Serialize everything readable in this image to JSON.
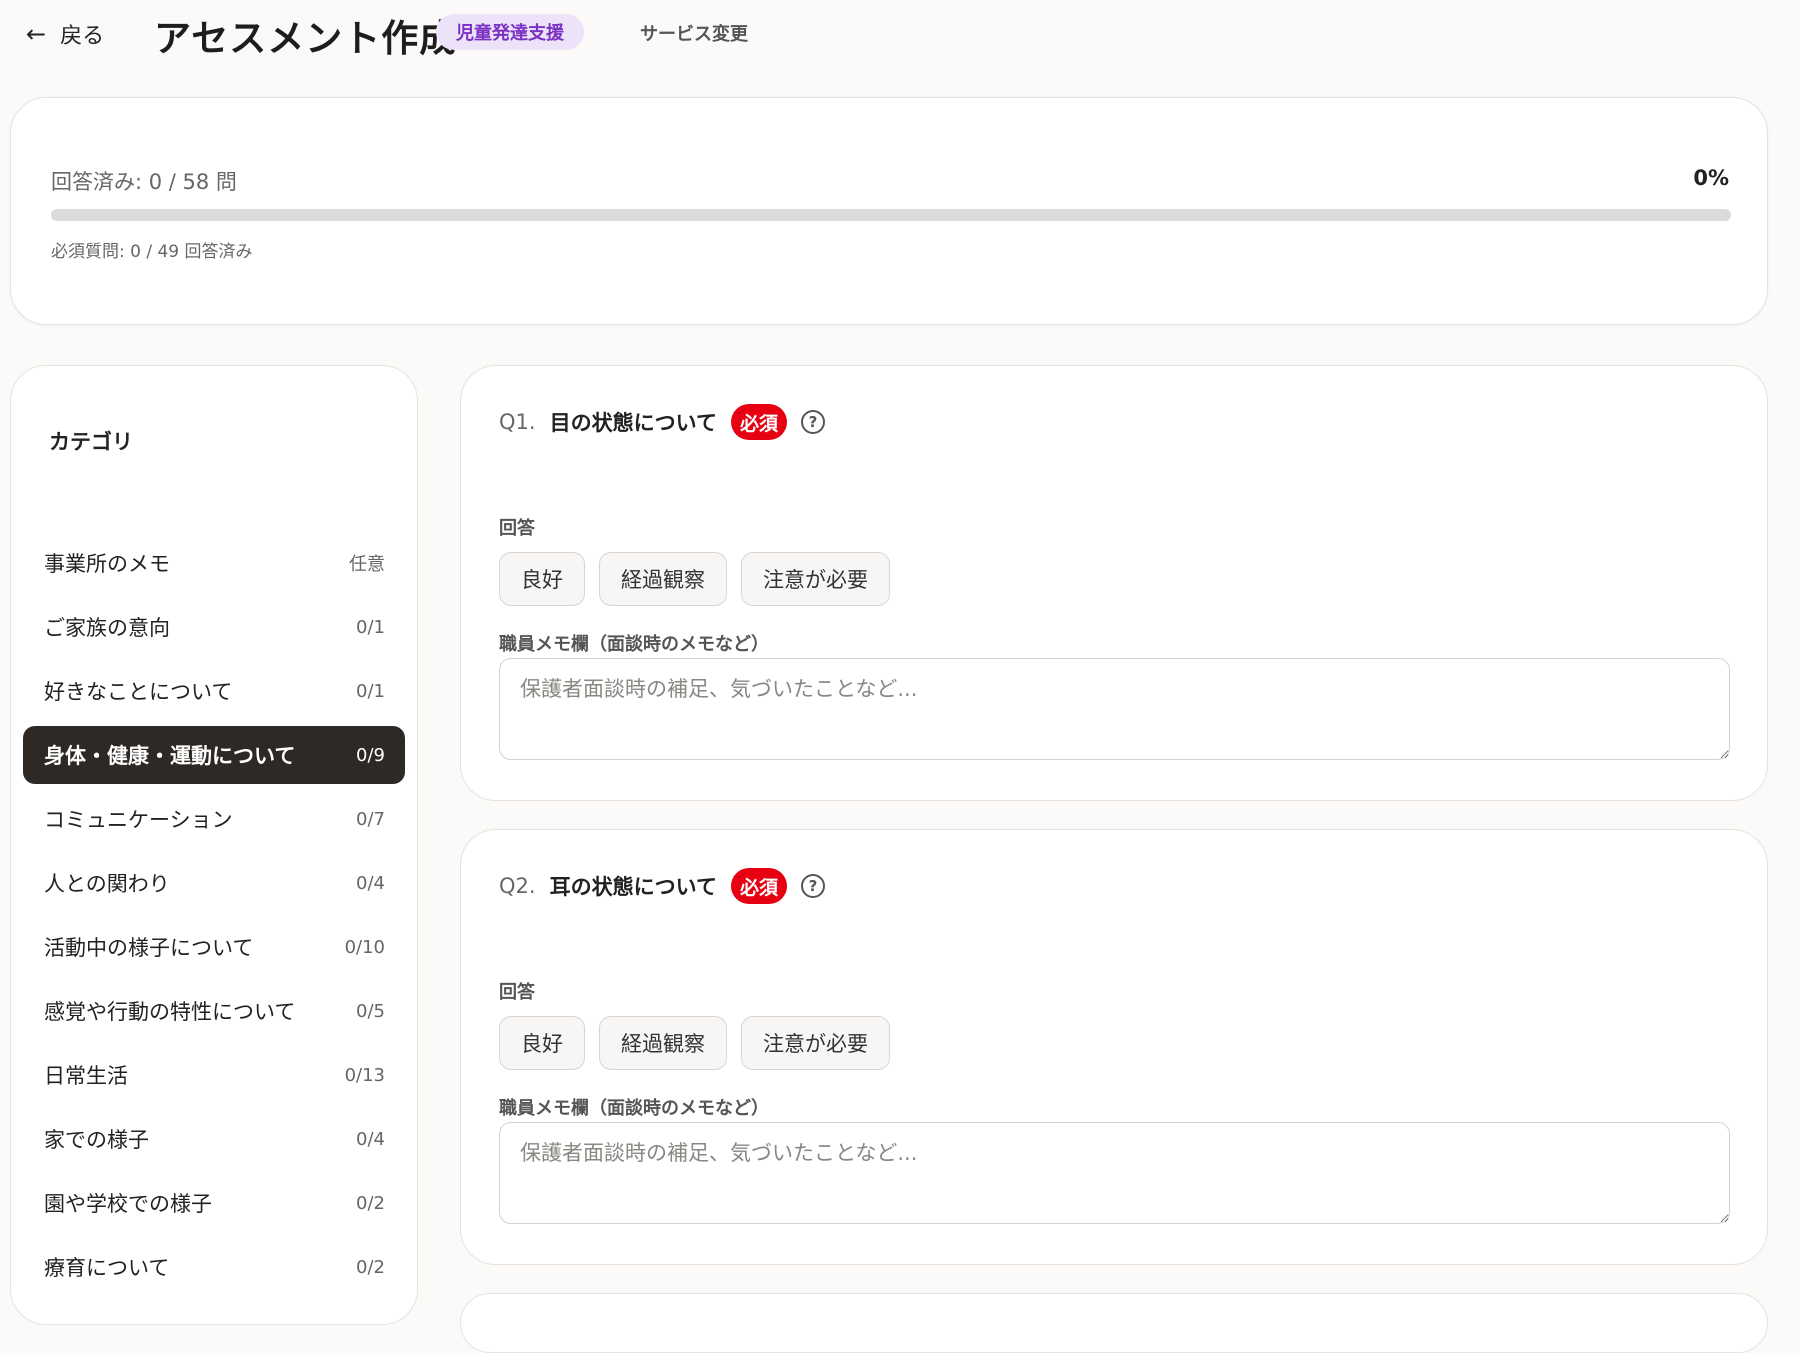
{
  "header": {
    "back_label": "戻る",
    "title": "アセスメント作成",
    "service_badge": "児童発達支援",
    "service_change": "サービス変更"
  },
  "progress": {
    "answered_text": "回答済み: 0 / 58 問",
    "percent_text": "0%",
    "fraction": 0,
    "required_text": "必須質問: 0 / 49 回答済み",
    "accent_color": "#7a31c4"
  },
  "sidebar": {
    "title": "カテゴリ",
    "items": [
      {
        "label": "事業所のメモ",
        "count": "任意"
      },
      {
        "label": "ご家族の意向",
        "count": "0/1"
      },
      {
        "label": "好きなことについて",
        "count": "0/1"
      },
      {
        "label": "身体・健康・運動について",
        "count": "0/9",
        "active": true
      },
      {
        "label": "コミュニケーション",
        "count": "0/7"
      },
      {
        "label": "人との関わり",
        "count": "0/4"
      },
      {
        "label": "活動中の様子について",
        "count": "0/10"
      },
      {
        "label": "感覚や行動の特性について",
        "count": "0/5"
      },
      {
        "label": "日常生活",
        "count": "0/13"
      },
      {
        "label": "家での様子",
        "count": "0/4"
      },
      {
        "label": "園や学校での様子",
        "count": "0/2"
      },
      {
        "label": "療育について",
        "count": "0/2"
      }
    ]
  },
  "questions": [
    {
      "num": "Q1.",
      "title": "目の状態について",
      "required": "必須",
      "help_icon": "help-circle-icon",
      "answer_label": "回答",
      "options": [
        "良好",
        "経過観察",
        "注意が必要"
      ],
      "memo_label": "職員メモ欄（面談時のメモなど）",
      "memo_placeholder": "保護者面談時の補足、気づいたことなど..."
    },
    {
      "num": "Q2.",
      "title": "耳の状態について",
      "required": "必須",
      "help_icon": "help-circle-icon",
      "answer_label": "回答",
      "options": [
        "良好",
        "経過観察",
        "注意が必要"
      ],
      "memo_label": "職員メモ欄（面談時のメモなど）",
      "memo_placeholder": "保護者面談時の補足、気づいたことなど..."
    }
  ],
  "colors": {
    "required_badge": "#e60012",
    "active_category_bg": "#2e2924",
    "service_badge_bg": "#ece3f8"
  }
}
